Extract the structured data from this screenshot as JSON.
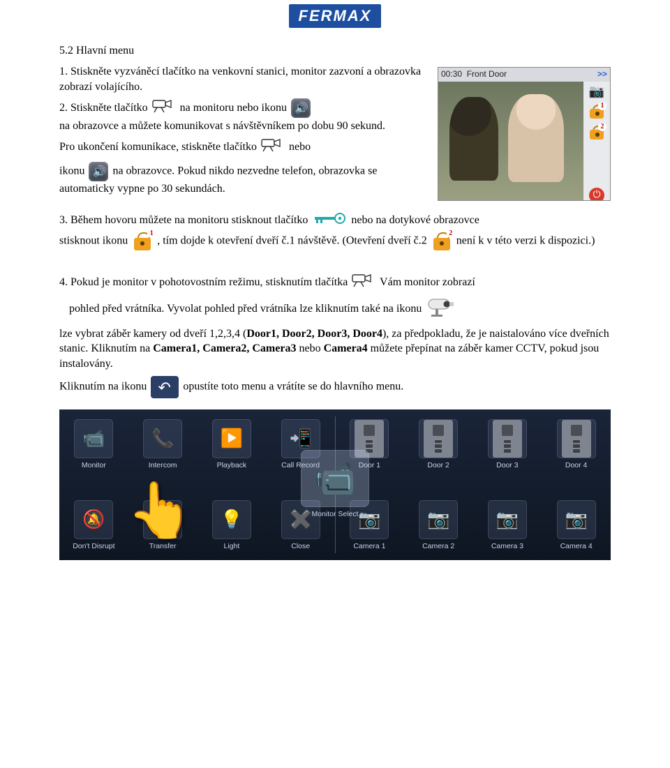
{
  "logo": "FERMAX",
  "section_heading": "5.2 Hlavní menu",
  "step1": "1. Stiskněte vyzváněcí tlačítko na venkovní stanici, monitor zazvoní a obrazovka zobrazí volajícího.",
  "step2_a": "2. Stiskněte tlačítko",
  "step2_b": "na monitoru nebo ikonu",
  "step2_c": "na obrazovce a můžete komunikovat s návštěvníkem po dobu 90 sekund.",
  "step2_d": "Pro ukončení komunikace, stiskněte tlačítko",
  "step2_e": "nebo",
  "step2_f": "ikonu",
  "step2_g": "na obrazovce. Pokud nikdo nezvedne telefon, obrazovka se automaticky vypne po 30 sekundách.",
  "step3_a": "3. Během hovoru můžete na monitoru stisknout tlačítko",
  "step3_b": "nebo na dotykové obrazovce",
  "step3_c": "stisknout ikonu",
  "step3_d": ", tím dojde k otevření dveří č.1 návštěvě. (Otevření dveří č.2",
  "step3_e": "není k v této verzi k dispozici.)",
  "step4_a": "4. Pokud je monitor v pohotovostním režimu, stisknutím tlačítka",
  "step4_b": "Vám monitor zobrazí",
  "step4_c": "pohled před vrátníka. Vyvolat pohled před vrátníka lze kliknutím také na ikonu",
  "step4_d": "lze vybrat záběr kamery od dveří 1,2,3,4 (",
  "step4_doors": "Door1, Door2,  Door3, Door4",
  "step4_e": "), za předpokladu, že je naistalováno více dveřních stanic. Kliknutím na ",
  "step4_cams": "Camera1, Camera2, Camera3",
  "step4_f": " nebo ",
  "step4_cam4": "Camera4",
  "step4_g": " můžete přepínat na záběr kamer CCTV, pokud jsou instalovány.",
  "step4_h": "Kliknutím na ikonu",
  "step4_i": "opustíte toto menu a vrátíte se do hlavního menu.",
  "device": {
    "time": "00:30",
    "title": "Front Door",
    "arrows": ">>",
    "lock1_badge": "1",
    "lock2_badge": "2"
  },
  "lock_badges": {
    "one": "1",
    "two": "2"
  },
  "menu": {
    "left_top": [
      "Monitor",
      "Intercom",
      "Playback",
      "Call Record"
    ],
    "left_bot": [
      "Don't Disrupt",
      "Transfer",
      "Light",
      "Close"
    ],
    "right_center": "Monitor Select",
    "right_top": [
      "Door 1",
      "Door 2",
      "Door 3",
      "Door 4"
    ],
    "right_bot": [
      "Camera 1",
      "Camera 2",
      "Camera 3",
      "Camera 4"
    ]
  }
}
